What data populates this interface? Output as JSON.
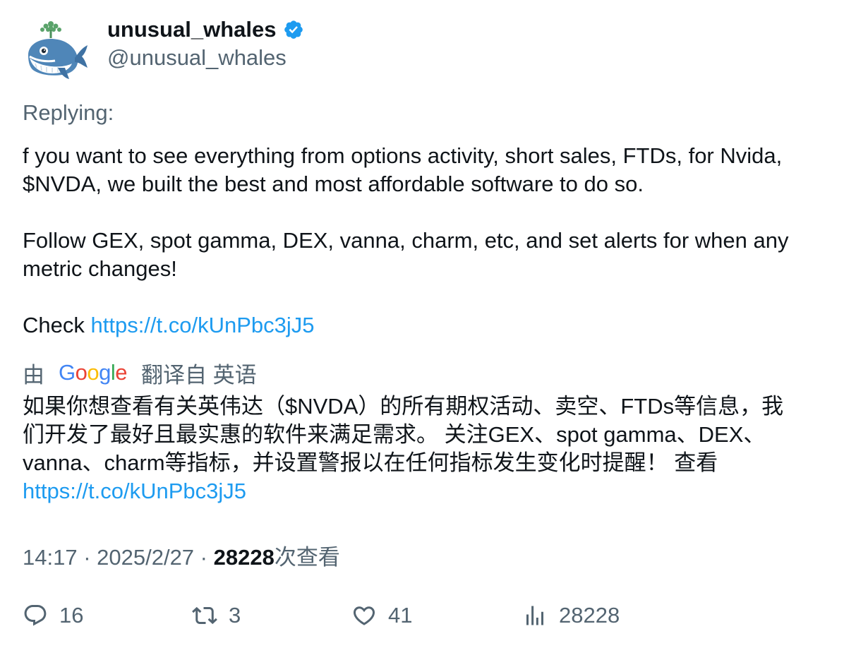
{
  "author": {
    "display_name": "unusual_whales",
    "handle": "@unusual_whales",
    "verified": true,
    "verified_color": "#1d9bf0"
  },
  "replying_label": "Replying:",
  "tweet": {
    "line1": "f you want to see everything from options activity, short sales, FTDs, for Nvida,",
    "line2": "$NVDA, we built the best and most affordable software to do so.",
    "line3": "Follow GEX, spot gamma, DEX, vanna, charm, etc, and set alerts for when any",
    "line4": "metric changes!",
    "check_prefix": "Check ",
    "link": "https://t.co/kUnPbc3jJ5"
  },
  "translation": {
    "by_label": "由",
    "provider": "Google",
    "from_label": "翻译自 英语",
    "line1": "如果你想查看有关英伟达（$NVDA）的所有期权活动、卖空、FTDs等信息，我",
    "line2": "们开发了最好且最实惠的软件来满足需求。 关注GEX、spot gamma、DEX、",
    "line3": "vanna、charm等指标，并设置警报以在任何指标发生变化时提醒！ 查看",
    "link": "https://t.co/kUnPbc3jJ5"
  },
  "meta": {
    "time": "14:17",
    "separator": " · ",
    "date": "2025/2/27",
    "views_count": "28228",
    "views_label": "次查看"
  },
  "actions": {
    "replies": "16",
    "retweets": "3",
    "likes": "41",
    "views": "28228"
  },
  "colors": {
    "text": "#0f1419",
    "secondary": "#536471",
    "link": "#1d9bf0"
  },
  "icons": {
    "avatar": "whale-avatar",
    "verified": "verified-badge-icon",
    "reply": "reply-icon",
    "retweet": "retweet-icon",
    "like": "heart-icon",
    "views": "views-bar-chart-icon"
  }
}
